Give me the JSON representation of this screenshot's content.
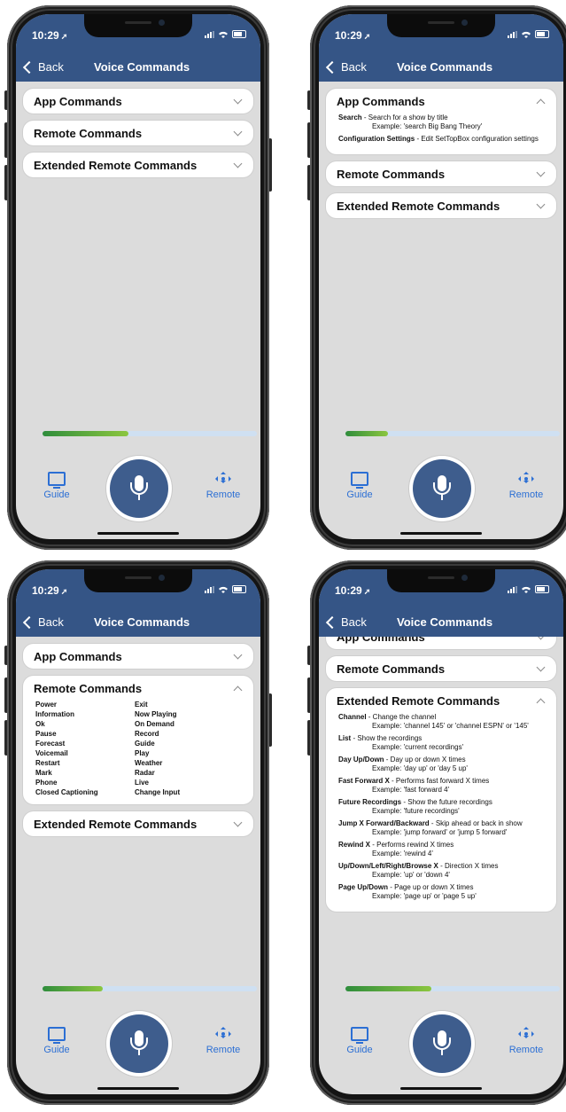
{
  "status": {
    "time": "10:29"
  },
  "nav": {
    "back_label": "Back",
    "title": "Voice Commands"
  },
  "sections": {
    "app": "App Commands",
    "remote": "Remote Commands",
    "extended": "Extended Remote Commands"
  },
  "app_commands": [
    {
      "name": "Search",
      "desc": " - Search for a show by title",
      "example": "Example: 'search Big Bang Theory'"
    },
    {
      "name": "Configuration Settings",
      "desc": " - Edit SetTopBox configuration settings",
      "example": ""
    }
  ],
  "remote_commands": {
    "left": [
      "Power",
      "Information",
      "Ok",
      "Pause",
      "Forecast",
      "Voicemail",
      "Restart",
      "Mark",
      "Phone",
      "Closed Captioning"
    ],
    "right": [
      "Exit",
      "Now Playing",
      "On Demand",
      "Record",
      "Guide",
      "Play",
      "Weather",
      "Radar",
      "Live",
      "Change Input"
    ]
  },
  "extended_commands": [
    {
      "name": "Channel",
      "desc": " - Change the channel",
      "example": "Example: 'channel 145' or 'channel ESPN' or '145'"
    },
    {
      "name": "List",
      "desc": " - Show the recordings",
      "example": "Example: 'current recordings'"
    },
    {
      "name": "Day Up/Down",
      "desc": " - Day up or down X times",
      "example": "Example: 'day up' or 'day 5 up'"
    },
    {
      "name": "Fast Forward X",
      "desc": " - Performs fast forward X times",
      "example": "Example: 'fast forward 4'"
    },
    {
      "name": "Future Recordings",
      "desc": " - Show the future recordings",
      "example": "Example: 'future recordings'"
    },
    {
      "name": "Jump X Forward/Backward",
      "desc": " - Skip ahead or back in show",
      "example": "Example: 'jump forward' or 'jump 5 forward'"
    },
    {
      "name": "Rewind X",
      "desc": " - Performs rewind X times",
      "example": "Example: 'rewind 4'"
    },
    {
      "name": "Up/Down/Left/Right/Browse X",
      "desc": " - Direction X times",
      "example": "Example: 'up' or 'down 4'"
    },
    {
      "name": "Page Up/Down",
      "desc": " - Page up or down X times",
      "example": "Example: 'page up' or 'page 5 up'"
    }
  ],
  "tabs": {
    "guide": "Guide",
    "remote": "Remote"
  },
  "colors": {
    "nav": "#355586",
    "accent": "#2c6fd4",
    "mic": "#3e5d8d",
    "progress": "#2f8d3c"
  },
  "phones": [
    {
      "state": "all-collapsed",
      "progress": 0.4
    },
    {
      "state": "app-expanded",
      "progress": 0.2
    },
    {
      "state": "remote-expanded",
      "progress": 0.28
    },
    {
      "state": "extended-expanded",
      "progress": 0.4
    }
  ]
}
